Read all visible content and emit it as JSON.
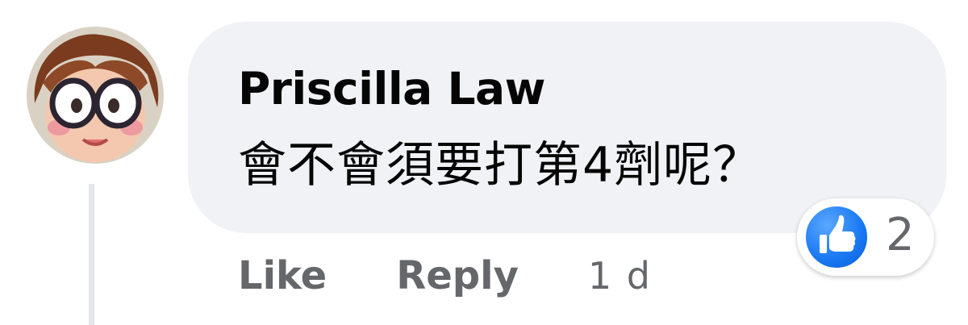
{
  "comment": {
    "author": "Priscilla Law",
    "text": "會不會須要打第4劑呢？",
    "reaction_count": "2",
    "actions": {
      "like_label": "Like",
      "reply_label": "Reply",
      "timestamp": "1 d"
    }
  },
  "icons": {
    "avatar": "cartoon-avatar-icon",
    "reaction": "thumbs-up-icon"
  },
  "colors": {
    "bubble": "#f0f2f5",
    "text_primary": "#050505",
    "text_secondary": "#65676b",
    "like_blue": "#1877f2",
    "thread_line": "#e4e6eb"
  }
}
